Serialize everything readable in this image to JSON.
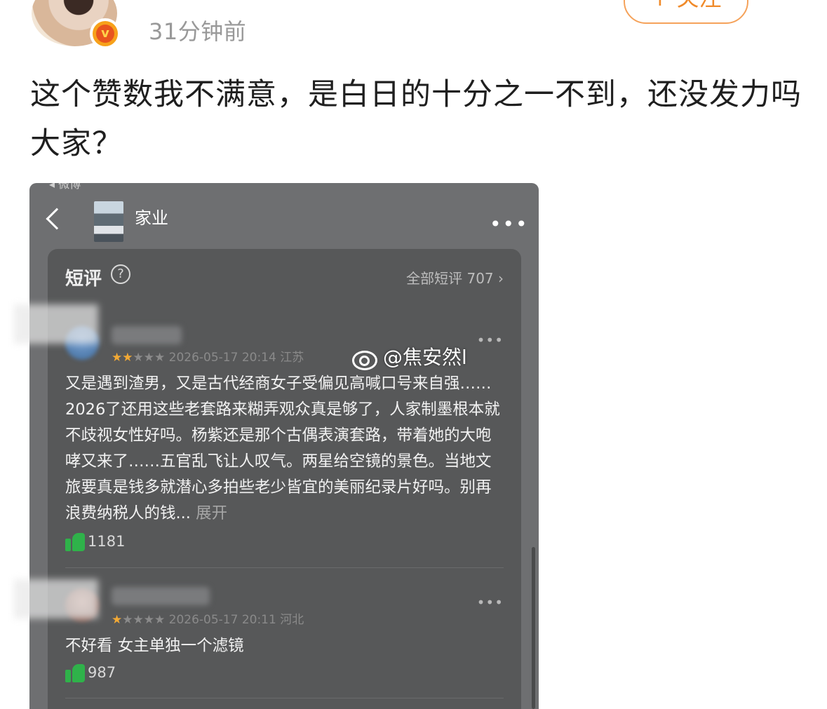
{
  "post": {
    "time": "31分钟前",
    "follow_label": "+ 关注",
    "text": "这个赞数我不满意，是白日的十分之一不到，还没发力吗大家？"
  },
  "screenshot": {
    "status_text": "◂ 微博",
    "show_title": "家业",
    "section_title": "短评",
    "help_glyph": "?",
    "all_reviews_link": "全部短评 707 ›",
    "reviews": [
      {
        "rating": 2,
        "stars": "★★★★★",
        "date": "2026-05-17 20:14",
        "location": "江苏",
        "text": "又是遇到渣男，又是古代经商女子受偏见高喊口号来自强……2026了还用这些老套路来糊弄观众真是够了，人家制墨根本就不歧视女性好吗。杨紫还是那个古偶表演套路，带着她的大咆哮又来了……五官乱飞让人叹气。两星给空镜的景色。当地文旅要真是钱多就潜心多拍些老少皆宜的美丽纪录片好吗。别再浪费纳税人的钱...",
        "expand_label": "展开",
        "likes": "1181"
      },
      {
        "rating": 1,
        "stars": "★★★★★",
        "date": "2026-05-17 20:11",
        "location": "河北",
        "text": "不好看  女主单独一个滤镜",
        "likes": "987"
      }
    ]
  },
  "watermark": {
    "text": "@焦安然l"
  },
  "colors": {
    "follow_accent": "#f08a2a",
    "star_on": "#f2a935",
    "like_green": "#2fb24a",
    "panel_bg": "#575859"
  }
}
